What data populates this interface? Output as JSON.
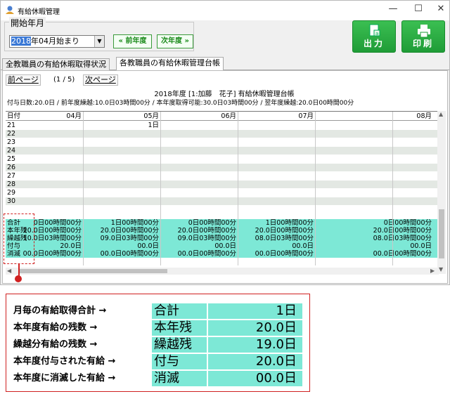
{
  "window": {
    "title": "有給休暇管理",
    "controls": [
      "minimize-icon",
      "maximize-icon",
      "close-icon"
    ]
  },
  "toolbar": {
    "period_label": "開始年月",
    "period_value_highlight": "2018",
    "period_value_rest": "年04月始まり",
    "prev_year_label": "« 前年度",
    "next_year_label": "次年度 »",
    "output_label": "出力",
    "print_label": "印刷"
  },
  "tabs": [
    {
      "label": "全教職員の有給休暇取得状況",
      "active": false
    },
    {
      "label": "各教職員の有給休暇管理台帳",
      "active": true
    }
  ],
  "pager": {
    "prev_label": "前ページ",
    "info": "(1 / 5)",
    "next_label": "次ページ"
  },
  "ledger": {
    "title": "2018年度 [1:加藤　花子] 有給休暇管理台帳",
    "summary": "付与日数:20.0日 / 前年度繰越:10.0日03時間00分 / 本年度取得可能:30.0日03時間00分 / 翌年度繰越:20.0日00時間00分"
  },
  "grid": {
    "date_header": "日付",
    "months": [
      "04月",
      "05月",
      "06月",
      "07月",
      "08月"
    ],
    "day_rows": [
      {
        "day": "21",
        "cells": [
          "",
          "1日",
          "",
          "",
          ""
        ]
      },
      {
        "day": "22",
        "cells": [
          "",
          "",
          "",
          "",
          ""
        ]
      },
      {
        "day": "23",
        "cells": [
          "",
          "",
          "",
          "",
          ""
        ]
      },
      {
        "day": "24",
        "cells": [
          "",
          "",
          "",
          "",
          ""
        ]
      },
      {
        "day": "25",
        "cells": [
          "",
          "",
          "",
          "",
          ""
        ]
      },
      {
        "day": "26",
        "cells": [
          "",
          "",
          "",
          "",
          ""
        ]
      },
      {
        "day": "27",
        "cells": [
          "",
          "",
          "",
          "",
          ""
        ]
      },
      {
        "day": "28",
        "cells": [
          "",
          "",
          "",
          "",
          ""
        ]
      },
      {
        "day": "29",
        "cells": [
          "",
          "",
          "",
          "",
          ""
        ]
      },
      {
        "day": "30",
        "cells": [
          "",
          "",
          "",
          "",
          ""
        ]
      },
      {
        "day": "",
        "cells": [
          "",
          "",
          "",
          "",
          ""
        ]
      }
    ],
    "summary_rows": [
      {
        "label": "合計",
        "cells": [
          "0日00時間00分",
          "1日00時間00分",
          "0日00時間00分",
          "1日00時間00分",
          "0日00時間00分"
        ]
      },
      {
        "label": "本年残",
        "cells": [
          "20.0日00時間00分",
          "20.0日00時間00分",
          "20.0日00時間00分",
          "20.0日00時間00分",
          "20.0日00時間00分"
        ]
      },
      {
        "label": "繰越残",
        "cells": [
          "10.0日03時間00分",
          "09.0日03時間00分",
          "09.0日03時間00分",
          "08.0日03時間00分",
          "08.0日03時間00分"
        ]
      },
      {
        "label": "付与",
        "cells": [
          "20.0日",
          "00.0日",
          "00.0日",
          "00.0日",
          "00.0日"
        ]
      },
      {
        "label": "消滅",
        "cells": [
          "00.0日00時間00分",
          "00.0日00時間00分",
          "00.0日00時間00分",
          "00.0日00時間00分",
          "00.0日00時間00分"
        ]
      }
    ]
  },
  "legend": {
    "rows": [
      {
        "desc": "月毎の有給取得合計 →",
        "label": "合計",
        "value": "1日"
      },
      {
        "desc": "本年度有給の残数 →",
        "label": "本年残",
        "value": "20.0日"
      },
      {
        "desc": "繰越分有給の残数 →",
        "label": "繰越残",
        "value": "19.0日"
      },
      {
        "desc": "本年度付与された有給 →",
        "label": "付与",
        "value": "20.0日"
      },
      {
        "desc": "本年度に消滅した有給 →",
        "label": "消滅",
        "value": "00.0日"
      }
    ]
  },
  "colors": {
    "summary_bg": "#7de8d6",
    "accent_red": "#d02020",
    "button_green": "#2aaa44"
  }
}
